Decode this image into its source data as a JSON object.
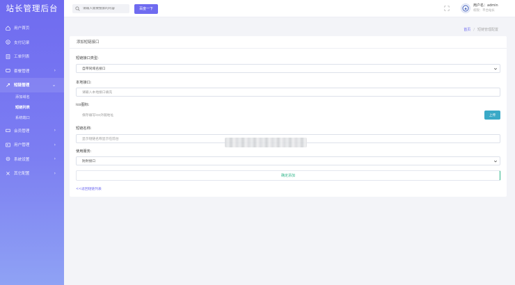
{
  "brand": "站长管理后台",
  "sidebar": {
    "items": [
      {
        "label": "用户首页",
        "icon": "home-icon"
      },
      {
        "label": "支付记录",
        "icon": "dollar-icon"
      },
      {
        "label": "工单列表",
        "icon": "ticket-icon"
      },
      {
        "label": "套餐管理",
        "icon": "package-icon"
      },
      {
        "label": "短链管理",
        "icon": "link-icon"
      },
      {
        "label": "会员管理",
        "icon": "member-icon"
      },
      {
        "label": "用户管理",
        "icon": "user-icon"
      },
      {
        "label": "系统设置",
        "icon": "gear-icon"
      },
      {
        "label": "其它配置",
        "icon": "config-icon"
      }
    ],
    "submenu": [
      "添加域名",
      "短链列表",
      "系统端口"
    ]
  },
  "header": {
    "search_placeholder": "请输入需要搜索的内容",
    "search_button": "百度一下",
    "username": "用户名：admin",
    "role": "权限：平台站长"
  },
  "breadcrumb": {
    "home": "首页",
    "sep": "/",
    "current": "短链管理配置"
  },
  "form": {
    "title": "添加短链接口",
    "type_label": "短链接口类型:",
    "type_value": "自带同域名接口",
    "api_label": "本地接口:",
    "api_placeholder": "请输入本地接口填充",
    "ico_label": "ico图标:",
    "ico_placeholder": "保存填写ico外链地址",
    "upload_button": "上传",
    "name_label": "短链名称:",
    "name_placeholder": "显示短链名称显示在前台",
    "service_label": "使用服务:",
    "service_value": "防封接口",
    "submit": "确定添加",
    "back": "<<返回短链列表"
  },
  "colors": {
    "accent": "#6f6bf0",
    "upload": "#3aa9c7",
    "submit": "#2fb58a"
  }
}
